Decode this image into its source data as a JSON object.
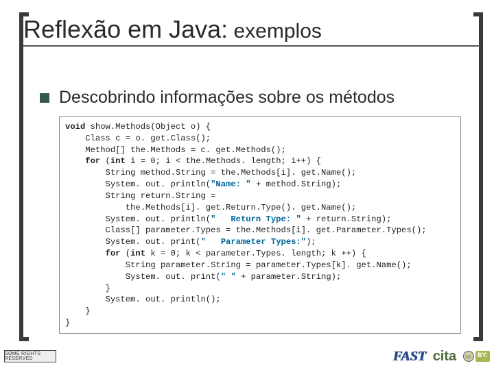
{
  "title": {
    "main": "Reflexão em Java:",
    "sub": " exemplos"
  },
  "bullet": "Descobrindo informações sobre os métodos",
  "code": {
    "l1a": "void",
    "l1b": " show.Methods(Object o) {",
    "l2": "    Class c = o. get.Class();",
    "l3": "    Method[] the.Methods = c. get.Methods();",
    "l4a": "    ",
    "l4b": "for",
    "l4c": " (",
    "l4d": "int",
    "l4e": " i = 0; i < the.Methods. length; i++) {",
    "l5": "        String method.String = the.Methods[i]. get.Name();",
    "l6a": "        System. out. println(",
    "l6b": "\"Name: \"",
    "l6c": " + method.String);",
    "l7": "        String return.String =",
    "l8": "            the.Methods[i]. get.Return.Type(). get.Name();",
    "l9a": "        System. out. println(",
    "l9b": "\"   Return Type: \"",
    "l9c": " + return.String);",
    "l10": "        Class[] parameter.Types = the.Methods[i]. get.Parameter.Types();",
    "l11a": "        System. out. print(",
    "l11b": "\"   Parameter Types:\"",
    "l11c": ");",
    "l12a": "        ",
    "l12b": "for",
    "l12c": " (",
    "l12d": "int",
    "l12e": " k = 0; k < parameter.Types. length; k ++) {",
    "l13": "            String parameter.String = parameter.Types[k]. get.Name();",
    "l14a": "            System. out. print(",
    "l14b": "\" \"",
    "l14c": " + parameter.String);",
    "l15": "        }",
    "l16": "        System. out. println();",
    "l17": "    }",
    "l18": "}"
  },
  "footer": {
    "cc_text": "SOME RIGHTS RESERVED",
    "fast": "FAST",
    "cita": "cita",
    "by": "BY:",
    "cc": "cc"
  }
}
